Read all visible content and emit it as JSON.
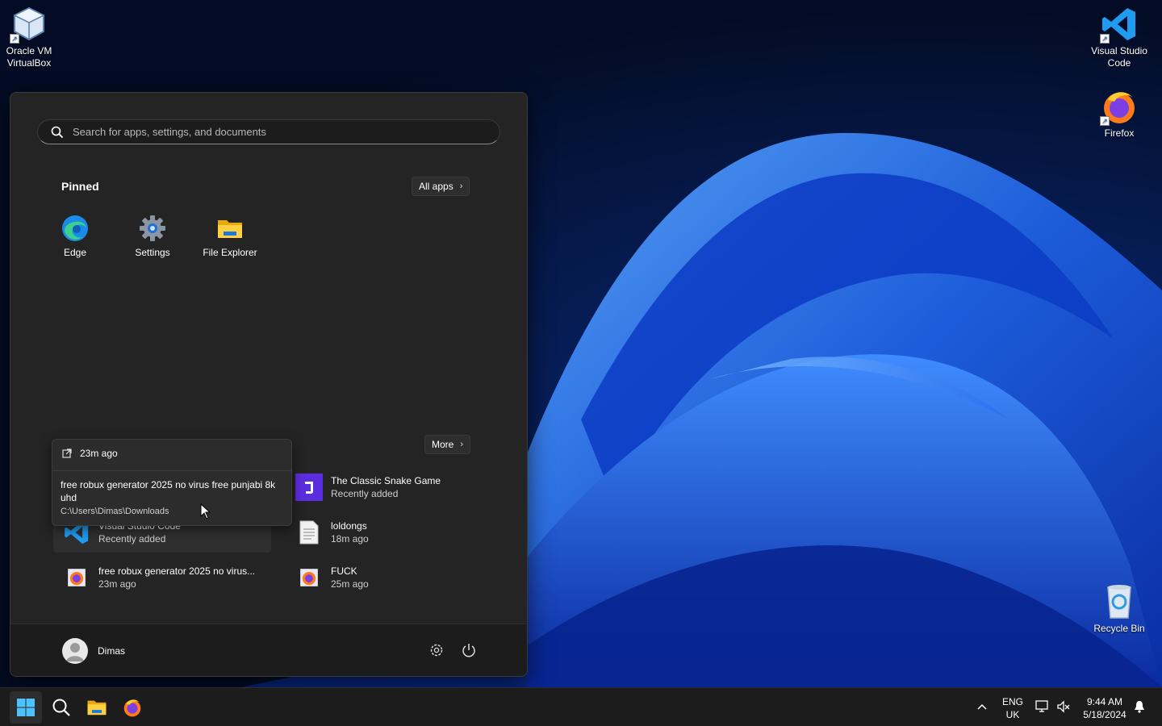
{
  "desktop": {
    "icons": [
      {
        "label": "Oracle VM VirtualBox",
        "icon": "virtualbox-icon"
      },
      {
        "label": "Visual Studio Code",
        "icon": "vscode-icon"
      },
      {
        "label": "Firefox",
        "icon": "firefox-icon"
      },
      {
        "label": "Recycle Bin",
        "icon": "recycle-bin-icon"
      }
    ]
  },
  "start_menu": {
    "search": {
      "placeholder": "Search for apps, settings, and documents",
      "value": ""
    },
    "pinned": {
      "title": "Pinned",
      "all_apps_label": "All apps",
      "apps": [
        {
          "label": "Edge",
          "icon": "edge-icon"
        },
        {
          "label": "Settings",
          "icon": "settings-gear-icon"
        },
        {
          "label": "File Explorer",
          "icon": "folder-icon"
        }
      ]
    },
    "recommended": {
      "more_label": "More",
      "items": [
        {
          "name": "Visual Studio Code",
          "sub": "Recently added",
          "icon": "vscode-icon"
        },
        {
          "name": "The Classic Snake Game",
          "sub": "Recently added",
          "icon": "snake-game-icon"
        },
        {
          "name": "loldongs",
          "sub": "18m ago",
          "icon": "document-icon"
        },
        {
          "name": "free robux generator 2025 no virus...",
          "sub": "23m ago",
          "icon": "firefox-icon"
        },
        {
          "name": "FUCK",
          "sub": "25m ago",
          "icon": "firefox-icon"
        }
      ]
    },
    "tooltip": {
      "time": "23m ago",
      "title": "free robux generator 2025 no virus free punjabi 8k uhd",
      "path": "C:\\Users\\Dimas\\Downloads"
    },
    "footer": {
      "user": "Dimas"
    }
  },
  "taskbar": {
    "language": {
      "line1": "ENG",
      "line2": "UK"
    },
    "clock": {
      "time": "9:44 AM",
      "date": "5/18/2024"
    }
  },
  "colors": {
    "accent": "#0067c0",
    "menu_bg": "#242424",
    "taskbar_bg": "#1c1c1c"
  }
}
